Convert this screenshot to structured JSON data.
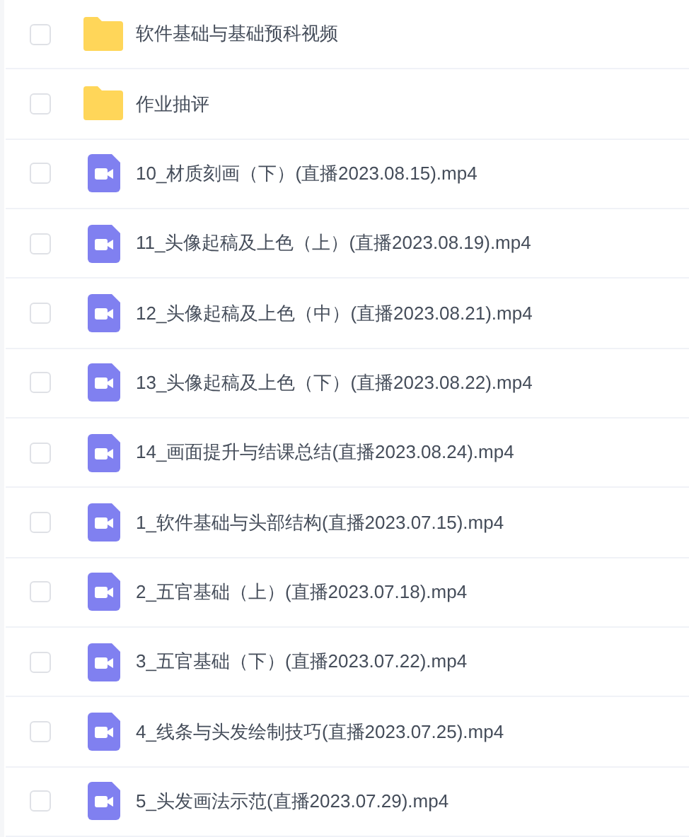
{
  "files": [
    {
      "kind": "folder",
      "name": "软件基础与基础预科视频",
      "checked": false
    },
    {
      "kind": "folder",
      "name": "作业抽评",
      "checked": false
    },
    {
      "kind": "video",
      "name": "10_材质刻画（下）(直播2023.08.15).mp4",
      "checked": false
    },
    {
      "kind": "video",
      "name": "11_头像起稿及上色（上）(直播2023.08.19).mp4",
      "checked": false
    },
    {
      "kind": "video",
      "name": "12_头像起稿及上色（中）(直播2023.08.21).mp4",
      "checked": false
    },
    {
      "kind": "video",
      "name": "13_头像起稿及上色（下）(直播2023.08.22).mp4",
      "checked": false
    },
    {
      "kind": "video",
      "name": "14_画面提升与结课总结(直播2023.08.24).mp4",
      "checked": false
    },
    {
      "kind": "video",
      "name": "1_软件基础与头部结构(直播2023.07.15).mp4",
      "checked": false
    },
    {
      "kind": "video",
      "name": "2_五官基础（上）(直播2023.07.18).mp4",
      "checked": false
    },
    {
      "kind": "video",
      "name": "3_五官基础（下）(直播2023.07.22).mp4",
      "checked": false
    },
    {
      "kind": "video",
      "name": "4_线条与头发绘制技巧(直播2023.07.25).mp4",
      "checked": false
    },
    {
      "kind": "video",
      "name": "5_头发画法示范(直播2023.07.29).mp4",
      "checked": false
    }
  ]
}
